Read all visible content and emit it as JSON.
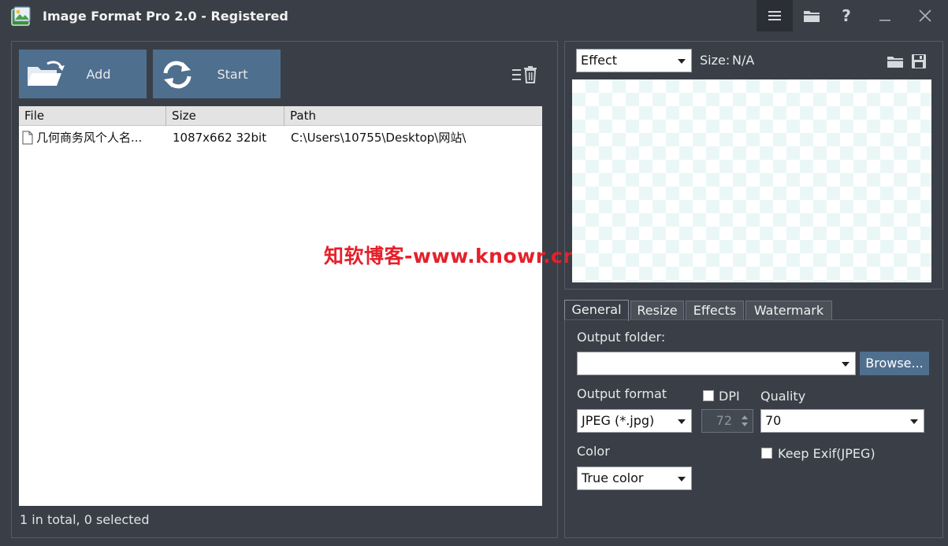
{
  "titlebar": {
    "title": "Image Format Pro 2.0 - Registered",
    "icons": [
      "app-icon",
      "menu-icon",
      "folder-icon",
      "help-icon",
      "minimize-icon",
      "close-icon"
    ],
    "help_label": "?"
  },
  "toolbar": {
    "add_label": "Add",
    "start_label": "Start"
  },
  "filelist": {
    "columns": [
      "File",
      "Size",
      "Path"
    ],
    "rows": [
      {
        "file": "几何商务风个人名...",
        "size": "1087x662  32bit",
        "path": "C:\\Users\\10755\\Desktop\\网站\\"
      }
    ]
  },
  "status": {
    "text": "1 in total, 0 selected"
  },
  "watermark": {
    "text": "知软博客-www.knowr.cn"
  },
  "preview": {
    "effect_value": "Effect",
    "size_label": "Size:",
    "size_value": "N/A"
  },
  "settings": {
    "tabs": [
      "General",
      "Resize",
      "Effects",
      "Watermark"
    ],
    "active_tab": "General",
    "output_folder_label": "Output folder:",
    "output_folder_value": "",
    "browse_label": "Browse...",
    "output_format_label": "Output format",
    "output_format_value": "JPEG (*.jpg)",
    "dpi_label": "DPI",
    "dpi_checked": false,
    "dpi_value": "72",
    "quality_label": "Quality",
    "quality_value": "70",
    "color_label": "Color",
    "color_value": "True color",
    "keep_exif_label": "Keep Exif(JPEG)",
    "keep_exif_checked": false
  },
  "colors": {
    "background": "#3a3f47",
    "accent_button": "#4f6f8f",
    "watermark": "#e5202a"
  }
}
